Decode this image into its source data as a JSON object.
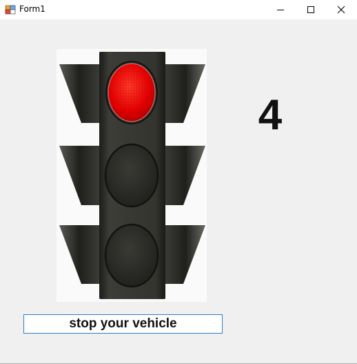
{
  "window": {
    "title": "Form1",
    "controls": {
      "minimize": "minimize-icon",
      "maximize": "maximize-icon",
      "close": "close-icon"
    }
  },
  "traffic_light": {
    "active_lamp": "red",
    "colors": {
      "red": "#e60000",
      "off": "#2a2a26",
      "housing": "#2e2e2b"
    }
  },
  "counter": {
    "value": "4"
  },
  "message": {
    "text": "stop your vehicle"
  }
}
